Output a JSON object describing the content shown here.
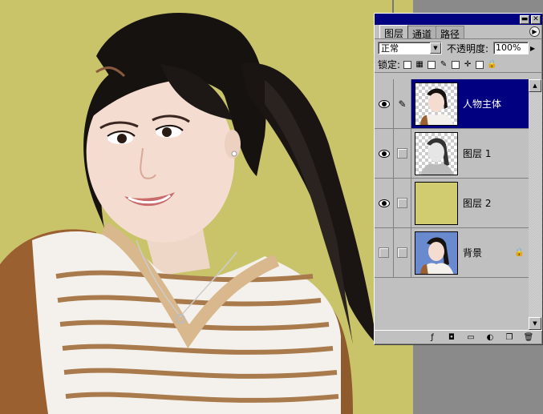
{
  "palette": {
    "title_buttons": [
      "▬",
      "✕"
    ],
    "tabs": [
      {
        "label": "图层",
        "active": true
      },
      {
        "label": "通道",
        "active": false
      },
      {
        "label": "路径",
        "active": false
      }
    ],
    "menu_arrow": "▶",
    "blend_mode": "正常",
    "opacity_label": "不透明度:",
    "opacity_value": "100%",
    "lock_label": "锁定:",
    "lock_icons": [
      "transparency-lock-icon",
      "brush-lock-icon",
      "move-lock-icon",
      "all-lock-icon"
    ],
    "layers": [
      {
        "name": "人物主体",
        "visible": true,
        "brush": true,
        "selected": true,
        "thumb": "portrait-cutout"
      },
      {
        "name": "图层 1",
        "visible": true,
        "brush": false,
        "selected": false,
        "thumb": "transparent-cutout"
      },
      {
        "name": "图层 2",
        "visible": true,
        "brush": false,
        "selected": false,
        "thumb": "yellow-fill"
      },
      {
        "name": "背景",
        "visible": false,
        "brush": false,
        "selected": false,
        "locked": true,
        "thumb": "photo"
      }
    ],
    "bottom_icons": [
      "layer-style-icon",
      "mask-icon",
      "new-set-icon",
      "adjustment-layer-icon",
      "new-layer-icon",
      "trash-icon"
    ]
  },
  "colors": {
    "background": "#c9c46a",
    "selected": "#000080",
    "panel": "#c0c0c0"
  }
}
